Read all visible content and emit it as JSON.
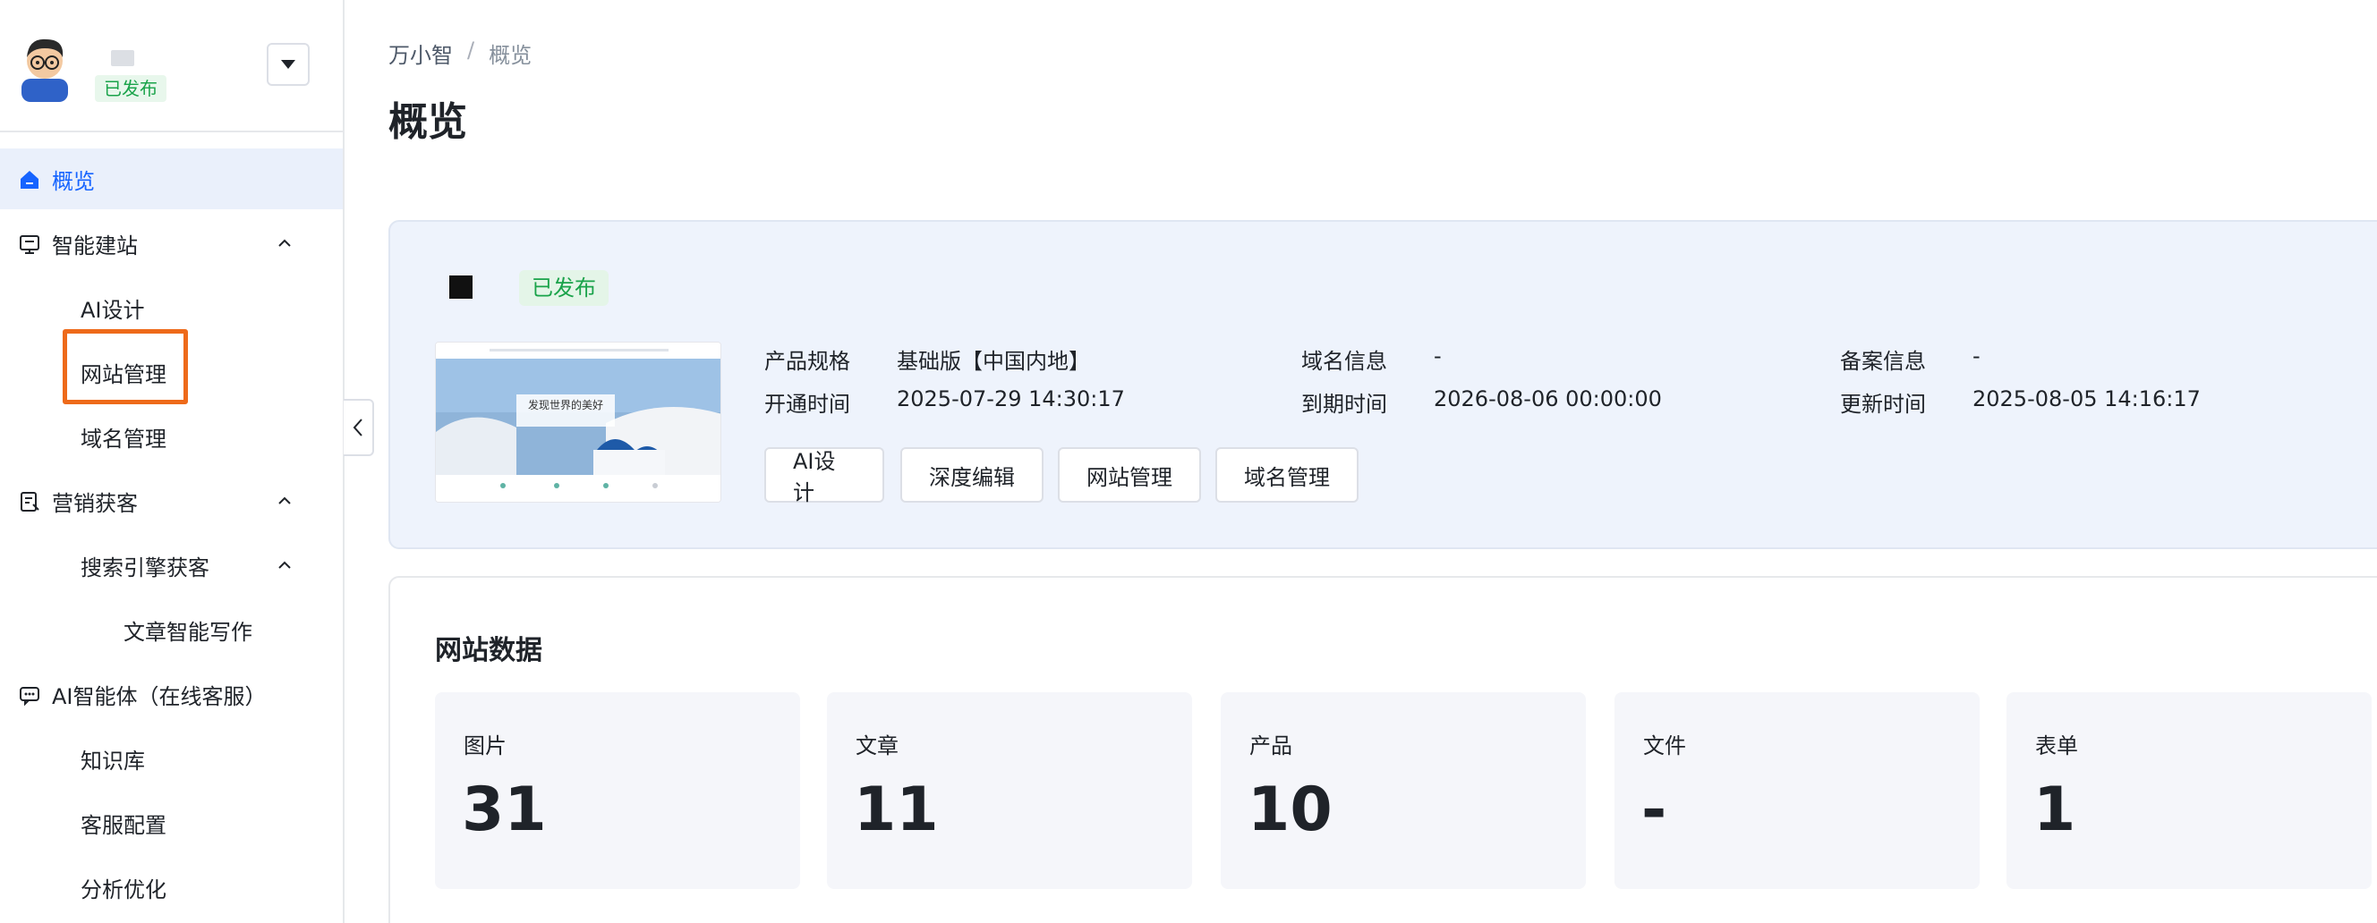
{
  "sidebar": {
    "status": "已发布",
    "items": [
      {
        "label": "概览"
      },
      {
        "label": "智能建站"
      },
      {
        "label": "AI设计"
      },
      {
        "label": "网站管理"
      },
      {
        "label": "域名管理"
      },
      {
        "label": "营销获客"
      },
      {
        "label": "搜索引擎获客"
      },
      {
        "label": "文章智能写作"
      },
      {
        "label": "AI智能体（在线客服）"
      },
      {
        "label": "知识库"
      },
      {
        "label": "客服配置"
      },
      {
        "label": "分析优化"
      }
    ]
  },
  "breadcrumb": {
    "root": "万小智",
    "sep": "/",
    "current": "概览"
  },
  "page_title": "概览",
  "site": {
    "status": "已发布",
    "thumb_text": "发现世界的美好",
    "fields": {
      "spec_label": "产品规格",
      "spec_value": "基础版【中国内地】",
      "open_label": "开通时间",
      "open_value": "2025-07-29 14:30:17",
      "domain_label": "域名信息",
      "domain_value": "-",
      "expire_label": "到期时间",
      "expire_value": "2026-08-06 00:00:00",
      "icp_label": "备案信息",
      "icp_value": "-",
      "update_label": "更新时间",
      "update_value": "2025-08-05 14:16:17"
    },
    "actions": [
      "AI设计",
      "深度编辑",
      "网站管理",
      "域名管理"
    ]
  },
  "data": {
    "title": "网站数据",
    "stats": [
      {
        "label": "图片",
        "value": "31"
      },
      {
        "label": "文章",
        "value": "11"
      },
      {
        "label": "产品",
        "value": "10"
      },
      {
        "label": "文件",
        "value": "-"
      },
      {
        "label": "表单",
        "value": "1"
      }
    ]
  },
  "colors": {
    "accent": "#1664ff",
    "success": "#1aa34a",
    "highlight": "#ee6a1a"
  }
}
